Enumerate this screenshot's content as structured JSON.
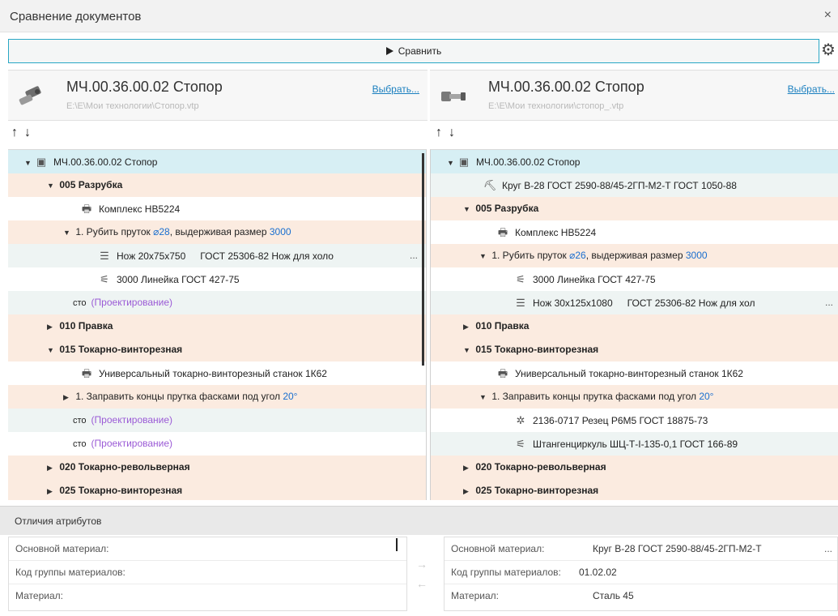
{
  "window": {
    "title": "Сравнение документов",
    "close": "×"
  },
  "toolbar": {
    "compare_label": "Сравнить",
    "settings_icon": "gear-icon"
  },
  "left_doc": {
    "name": "МЧ.00.36.00.02 Стопор",
    "path": "E:\\E\\Мои технологии\\Стопор.vtp",
    "select_label": "Выбрать..."
  },
  "right_doc": {
    "name": "МЧ.00.36.00.02 Стопор",
    "path": "E:\\E\\Мои технологии\\стопор_.vtp",
    "select_label": "Выбрать..."
  },
  "nav": {
    "up": "↑",
    "down": "↓"
  },
  "left_tree": {
    "root": "МЧ.00.36.00.02 Стопор",
    "op005": "005 Разрубка",
    "equip1": "Комплекс НВ5224",
    "step1_text": "1. Рубить пруток ",
    "step1_dim": "⌀28",
    "step1_mid": ", выдерживая размер ",
    "step1_size": "3000",
    "tool1_name": "Нож 20х75х750",
    "tool1_gost": "ГОСТ 25306-82 Нож для холо",
    "tool1_more": "...",
    "tool2": "3000 Линейка ГОСТ 427-75",
    "cto1_label": "сто",
    "cto1_value": "(Проектирование)",
    "op010": "010 Правка",
    "op015": "015 Токарно-винторезная",
    "equip2": "Универсальный токарно-винторезный станок 1К62",
    "step2_text": "1. Заправить концы прутка фасками под угол ",
    "step2_angle": "20°",
    "cto2_label": "сто",
    "cto2_value": "(Проектирование)",
    "cto3_label": "сто",
    "cto3_value": "(Проектирование)",
    "op020": "020 Токарно-револьверная",
    "op025": "025 Токарно-винторезная"
  },
  "right_tree": {
    "root": "МЧ.00.36.00.02 Стопор",
    "material": "Круг В-28 ГОСТ 2590-88/45-2ГП-М2-Т ГОСТ 1050-88",
    "op005": "005 Разрубка",
    "equip1": "Комплекс НВ5224",
    "step1_text": "1. Рубить пруток ",
    "step1_dim": "⌀26",
    "step1_mid": ", выдерживая размер ",
    "step1_size": "3000",
    "tool1": "3000 Линейка ГОСТ 427-75",
    "tool2_name": "Нож 30х125х1080",
    "tool2_gost": "ГОСТ 25306-82 Нож для хол",
    "tool2_more": "...",
    "op010": "010 Правка",
    "op015": "015 Токарно-винторезная",
    "equip2": "Универсальный токарно-винторезный станок 1К62",
    "step2_text": "1. Заправить концы прутка фасками под угол ",
    "step2_angle": "20°",
    "tool3": "2136-0717 Резец Р6М5 ГОСТ 18875-73",
    "tool4": "Штангенциркуль ШЦ-Т-I-135-0,1 ГОСТ 166-89",
    "op020": "020 Токарно-револьверная",
    "op025": "025 Токарно-винторезная"
  },
  "attributes": {
    "header": "Отличия атрибутов",
    "left": [
      {
        "label": "Основной материал:",
        "value": ""
      },
      {
        "label": "Код группы материалов:",
        "value": ""
      },
      {
        "label": "Материал:",
        "value": ""
      }
    ],
    "right": [
      {
        "label": "Основной материал:",
        "value": "Круг В-28 ГОСТ 2590-88/45-2ГП-М2-Т",
        "more": "..."
      },
      {
        "label": "Код группы материалов:",
        "value": "01.02.02"
      },
      {
        "label": "Материал:",
        "value": "Сталь 45"
      }
    ],
    "to_right": "→",
    "to_left": "←"
  },
  "colors": {
    "accent": "#29a7c4",
    "selected_row": "#d7eff4",
    "operation_row": "#fbebe0",
    "link": "#1a7fbf",
    "dimension": "#1a6fcf",
    "placeholder": "#9b5bd6"
  }
}
